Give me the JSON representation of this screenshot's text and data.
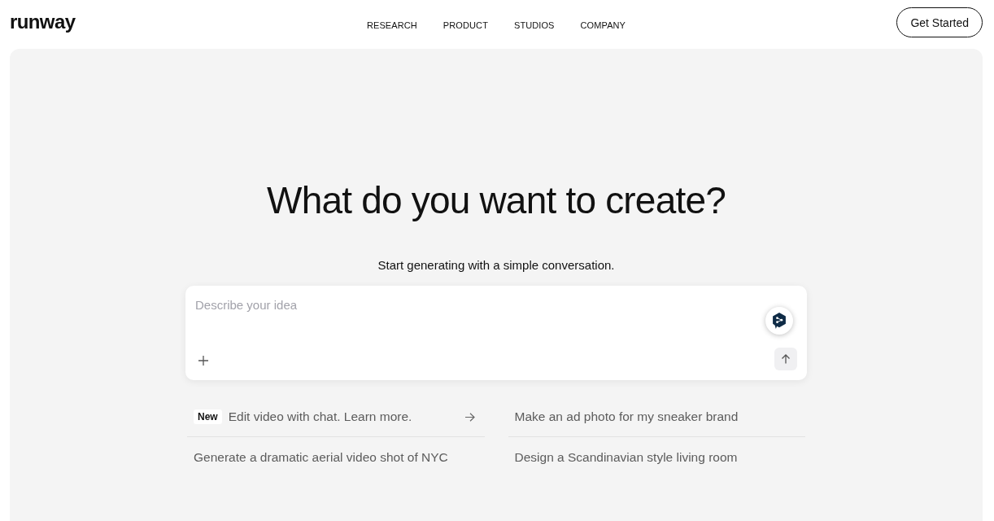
{
  "header": {
    "logo": "runway",
    "nav": [
      {
        "label": "RESEARCH"
      },
      {
        "label": "PRODUCT"
      },
      {
        "label": "STUDIOS"
      },
      {
        "label": "COMPANY"
      }
    ],
    "cta": "Get Started"
  },
  "hero": {
    "title": "What do you want to create?",
    "subtitle": "Start generating with a simple conversation."
  },
  "prompt_box": {
    "placeholder": "Describe your idea"
  },
  "suggestions": [
    {
      "kind": "announcement",
      "badge": "New",
      "text": "Edit video with chat. Learn more."
    },
    {
      "kind": "prompt",
      "text": "Make an ad photo for my sneaker brand"
    },
    {
      "kind": "prompt",
      "text": "Generate a dramatic aerial video shot of NYC"
    },
    {
      "kind": "prompt",
      "text": "Design a Scandinavian style living room"
    }
  ]
}
